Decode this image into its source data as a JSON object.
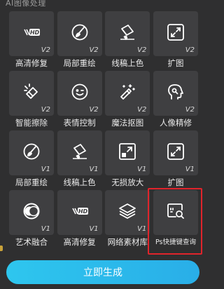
{
  "section_title": "AI图像处理",
  "rows": [
    [
      {
        "label": "高清修复",
        "version": "V2",
        "icon": "hd-icon"
      },
      {
        "label": "局部重绘",
        "version": "V2",
        "icon": "brush-icon"
      },
      {
        "label": "线稿上色",
        "version": "V2",
        "icon": "paint-bucket-icon"
      },
      {
        "label": "扩图",
        "version": "V2",
        "icon": "expand-icon"
      }
    ],
    [
      {
        "label": "智能擦除",
        "version": "V2",
        "icon": "eraser-icon"
      },
      {
        "label": "表情控制",
        "version": "V2",
        "icon": "face-icon"
      },
      {
        "label": "魔法抠图",
        "version": "V2",
        "icon": "magic-wand-icon"
      },
      {
        "label": "人像精修",
        "version": "V2",
        "icon": "portrait-icon"
      }
    ],
    [
      {
        "label": "局部重绘",
        "version": "V1",
        "icon": "brush-icon"
      },
      {
        "label": "线稿上色",
        "version": "V1",
        "icon": "paint-bucket-icon"
      },
      {
        "label": "无损放大",
        "version": "V1",
        "icon": "upscale-icon"
      },
      {
        "label": "扩图",
        "version": "V1",
        "icon": "expand-icon"
      }
    ],
    [
      {
        "label": "艺术融合",
        "version": "V1",
        "icon": "blend-icon"
      },
      {
        "label": "高清修复",
        "version": "V1",
        "icon": "hd-icon"
      },
      {
        "label": "网络素材库",
        "version": "V1",
        "icon": "layers-icon"
      },
      {
        "label": "Ps快捷键查询",
        "version": "",
        "icon": "shortcut-search-icon"
      }
    ]
  ],
  "hd_text": "HD",
  "generate_button": "立即生成",
  "colors": {
    "accent": "#2ec6ee",
    "highlight": "#e0242b",
    "tile": "#3f3f41",
    "background": "#2f2f30"
  }
}
